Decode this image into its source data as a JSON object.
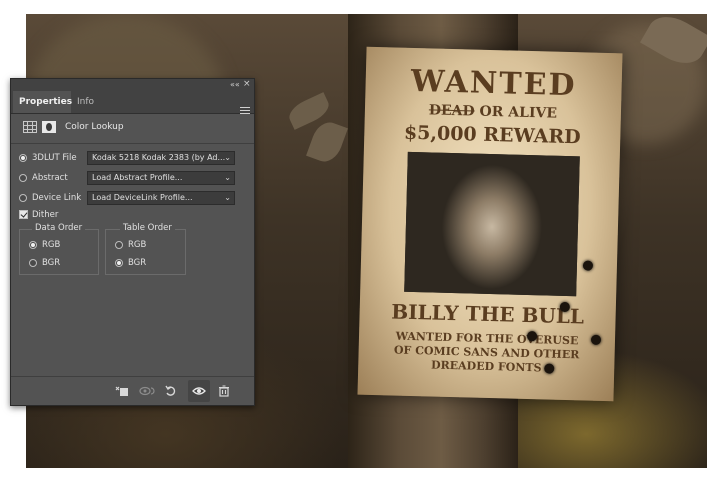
{
  "panel": {
    "tabs": [
      {
        "label": "Properties",
        "active": true
      },
      {
        "label": "Info",
        "active": false
      }
    ],
    "collapse_glyph": "««",
    "close_glyph": "×",
    "menu_icon": "hamburger-menu-icon",
    "adjustment_icons": [
      "color-lookup-grid-icon",
      "layer-mask-icon"
    ],
    "title": "Color Lookup",
    "options": [
      {
        "label": "3DLUT File",
        "selected": true,
        "value": "Kodak 5218 Kodak 2383 (by Ad..."
      },
      {
        "label": "Abstract",
        "selected": false,
        "value": "Load Abstract Profile..."
      },
      {
        "label": "Device Link",
        "selected": false,
        "value": "Load DeviceLink Profile..."
      }
    ],
    "dither": {
      "label": "Dither",
      "checked": true
    },
    "data_order": {
      "legend": "Data Order",
      "options": [
        {
          "label": "RGB",
          "selected": true
        },
        {
          "label": "BGR",
          "selected": false
        }
      ]
    },
    "table_order": {
      "legend": "Table Order",
      "options": [
        {
          "label": "RGB",
          "selected": false
        },
        {
          "label": "BGR",
          "selected": true
        }
      ]
    },
    "chevron": "⌄",
    "bottom_icons": [
      "clip-to-layer-icon",
      "view-previous-state-icon",
      "reset-icon",
      "visibility-eye-icon",
      "trash-icon"
    ]
  },
  "poster": {
    "heading": "WANTED",
    "dead": "DEAD",
    "or_alive": " OR ALIVE",
    "reward": "$5,000 REWARD",
    "name": "BILLY THE BULL",
    "line1": "WANTED FOR THE OVERUSE",
    "line2": "OF COMIC SANS AND OTHER",
    "line3": "DREADED FONTS"
  },
  "colors": {
    "panel_bg": "#535353",
    "tab_bar_bg": "#424242",
    "text": "#e2e2e2",
    "poster_paper": "#e6d3ae",
    "poster_ink": "#5a3d20"
  }
}
